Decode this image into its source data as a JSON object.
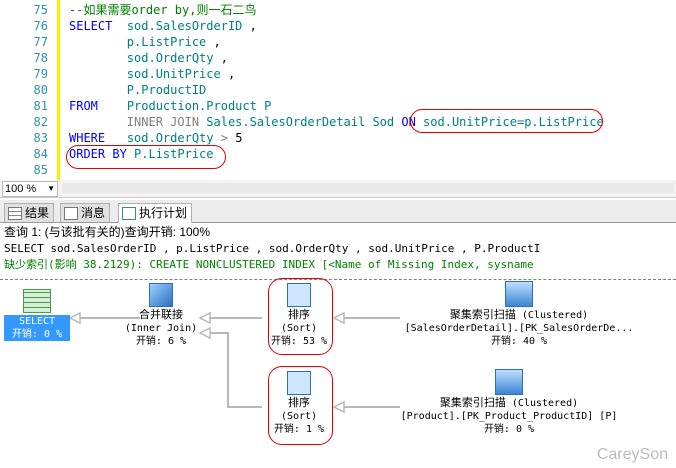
{
  "editor": {
    "lines": [
      {
        "num": "75",
        "parts": [
          {
            "c": "cm",
            "t": "--如果需要order by,则一石二鸟"
          }
        ]
      },
      {
        "num": "76",
        "parts": [
          {
            "c": "kw",
            "t": "SELECT"
          },
          {
            "c": "",
            "t": "  "
          },
          {
            "c": "tx",
            "t": "sod.SalesOrderID"
          },
          {
            "c": "",
            "t": " ,"
          }
        ]
      },
      {
        "num": "77",
        "parts": [
          {
            "c": "",
            "t": "        "
          },
          {
            "c": "tx",
            "t": "p.ListPrice"
          },
          {
            "c": "",
            "t": " ,"
          }
        ]
      },
      {
        "num": "78",
        "parts": [
          {
            "c": "",
            "t": "        "
          },
          {
            "c": "tx",
            "t": "sod.OrderQty"
          },
          {
            "c": "",
            "t": " ,"
          }
        ]
      },
      {
        "num": "79",
        "parts": [
          {
            "c": "",
            "t": "        "
          },
          {
            "c": "tx",
            "t": "sod.UnitPrice"
          },
          {
            "c": "",
            "t": " ,"
          }
        ]
      },
      {
        "num": "80",
        "parts": [
          {
            "c": "",
            "t": "        "
          },
          {
            "c": "tx",
            "t": "P.ProductID"
          }
        ]
      },
      {
        "num": "81",
        "parts": [
          {
            "c": "kw",
            "t": "FROM"
          },
          {
            "c": "",
            "t": "    "
          },
          {
            "c": "tx",
            "t": "Production.Product P"
          }
        ]
      },
      {
        "num": "82",
        "parts": [
          {
            "c": "",
            "t": "        "
          },
          {
            "c": "gr",
            "t": "INNER JOIN"
          },
          {
            "c": "",
            "t": " "
          },
          {
            "c": "tx",
            "t": "Sales.SalesOrderDetail Sod"
          },
          {
            "c": "",
            "t": " "
          },
          {
            "c": "kw",
            "t": "ON"
          },
          {
            "c": "",
            "t": " "
          },
          {
            "c": "tx",
            "t": "sod.UnitPrice=p.ListPrice"
          }
        ]
      },
      {
        "num": "83",
        "parts": [
          {
            "c": "kw",
            "t": "WHERE"
          },
          {
            "c": "",
            "t": "   "
          },
          {
            "c": "tx",
            "t": "sod.OrderQty"
          },
          {
            "c": "",
            "t": " "
          },
          {
            "c": "gr",
            "t": ">"
          },
          {
            "c": "",
            "t": " 5"
          }
        ]
      },
      {
        "num": "84",
        "parts": [
          {
            "c": "kw",
            "t": "ORDER BY"
          },
          {
            "c": "",
            "t": " "
          },
          {
            "c": "tx",
            "t": "P.ListPrice"
          }
        ]
      },
      {
        "num": "85",
        "parts": []
      }
    ]
  },
  "zoom": {
    "value": "100 %"
  },
  "tabs": [
    {
      "label": "结果",
      "icon": "results-grid-icon"
    },
    {
      "label": "消息",
      "icon": "messages-icon"
    },
    {
      "label": "执行计划",
      "icon": "execution-plan-icon"
    }
  ],
  "plan": {
    "query_header": "查询 1: (与该批有关的)查询开销: 100%",
    "query_text": "SELECT sod.SalesOrderID , p.ListPrice , sod.OrderQty , sod.UnitPrice , P.ProductI",
    "missing_index": "缺少索引(影响 38.2129): CREATE NONCLUSTERED INDEX [<Name of Missing Index, sysname",
    "nodes": {
      "select": {
        "label": "SELECT",
        "cost": "开销: 0 %"
      },
      "merge": {
        "name": "合并联接",
        "sub": "(Inner Join)",
        "cost": "开销: 6 %"
      },
      "sort1": {
        "name": "排序",
        "sub": "(Sort)",
        "cost": "开销: 53 %"
      },
      "sort2": {
        "name": "排序",
        "sub": "(Sort)",
        "cost": "开销: 1 %"
      },
      "scan1": {
        "name": "聚集索引扫描",
        "sub": "(Clustered)",
        "detail": "[SalesOrderDetail].[PK_SalesOrderDe...",
        "cost": "开销: 40 %"
      },
      "scan2": {
        "name": "聚集索引扫描",
        "sub": "(Clustered)",
        "detail": "[Product].[PK_Product_ProductID] [P]",
        "cost": "开销: 0 %"
      }
    }
  },
  "watermark": "CareySon",
  "colors": {
    "keyword": "#0000ff",
    "comment": "#008000",
    "identifier": "#008080",
    "gray": "#808080",
    "annotation": "#e00000"
  }
}
